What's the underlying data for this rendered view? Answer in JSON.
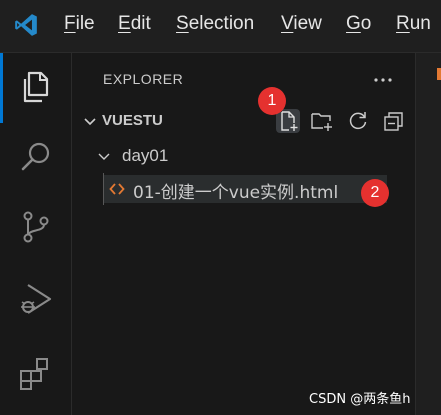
{
  "menubar": {
    "items": [
      {
        "mnemonic": "F",
        "rest": "ile"
      },
      {
        "mnemonic": "E",
        "rest": "dit"
      },
      {
        "mnemonic": "S",
        "rest": "election"
      },
      {
        "mnemonic": "V",
        "rest": "iew"
      },
      {
        "mnemonic": "G",
        "rest": "o"
      },
      {
        "mnemonic": "R",
        "rest": "un"
      }
    ]
  },
  "activitybar": {
    "icons": [
      "explorer-icon",
      "search-icon",
      "source-control-icon",
      "run-debug-icon",
      "extensions-icon"
    ],
    "active": "explorer-icon"
  },
  "explorer": {
    "title": "EXPLORER",
    "root": {
      "label": "VUESTU",
      "expanded": true
    },
    "toolbar": [
      "new-file-icon",
      "new-folder-icon",
      "refresh-icon",
      "collapse-all-icon"
    ],
    "folder": {
      "label": "day01",
      "expanded": true
    },
    "file": {
      "label": "01-创建一个vue实例.html",
      "icon": "html-file-icon"
    }
  },
  "annotations": {
    "badge1": "1",
    "badge2": "2"
  },
  "watermark": "CSDN @两条鱼h",
  "colors": {
    "accent": "#0078d4",
    "badge": "#e5312f",
    "html_icon": "#e37933"
  }
}
